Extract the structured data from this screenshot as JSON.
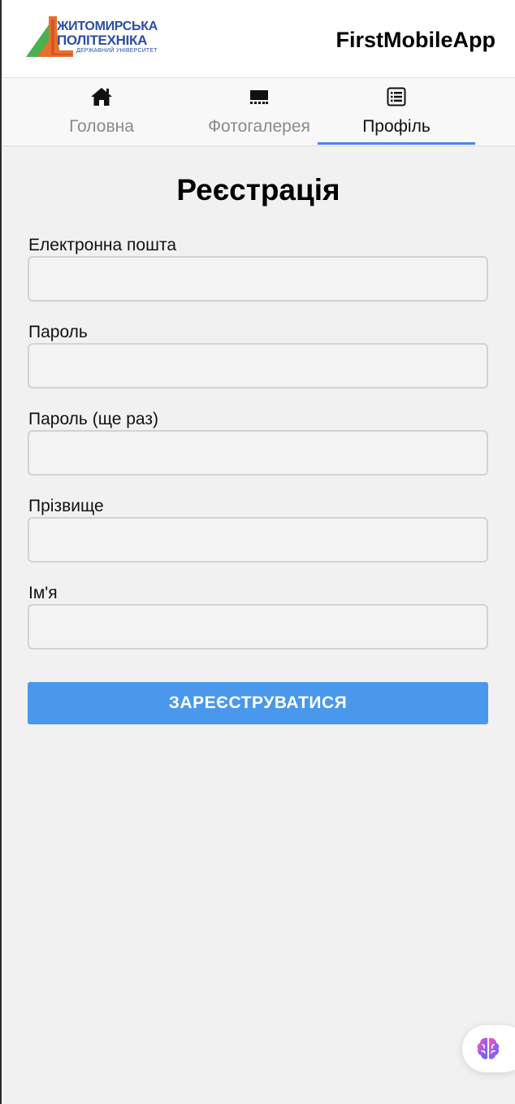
{
  "header": {
    "logo": {
      "line1": "ЖИТОМИРСЬКА",
      "line2": "ПОЛІТЕХНІКА",
      "line3": "ДЕРЖАВНИЙ УНІВЕРСИТЕТ"
    },
    "app_title": "FirstMobileApp"
  },
  "tabs": [
    {
      "label": "Головна",
      "icon": "home-icon",
      "active": false
    },
    {
      "label": "Фотогалерея",
      "icon": "gallery-icon",
      "active": false
    },
    {
      "label": "Профіль",
      "icon": "list-icon",
      "active": true
    }
  ],
  "form": {
    "title": "Реєстрація",
    "fields": [
      {
        "label": "Електронна пошта",
        "value": "",
        "placeholder": ""
      },
      {
        "label": "Пароль",
        "value": "",
        "placeholder": ""
      },
      {
        "label": "Пароль (ще раз)",
        "value": "",
        "placeholder": ""
      },
      {
        "label": "Прізвище",
        "value": "",
        "placeholder": ""
      },
      {
        "label": "Ім'я",
        "value": "",
        "placeholder": ""
      }
    ],
    "submit_label": "ЗАРЕЄСТРУВАТИСЯ"
  },
  "fab": {
    "icon": "brain-icon"
  },
  "colors": {
    "accent": "#4a86e8",
    "button": "#4a98ec",
    "background": "#f1f1f1",
    "logo_blue": "#2b4fa3",
    "logo_orange": "#e8702a",
    "logo_green": "#4caf50"
  }
}
